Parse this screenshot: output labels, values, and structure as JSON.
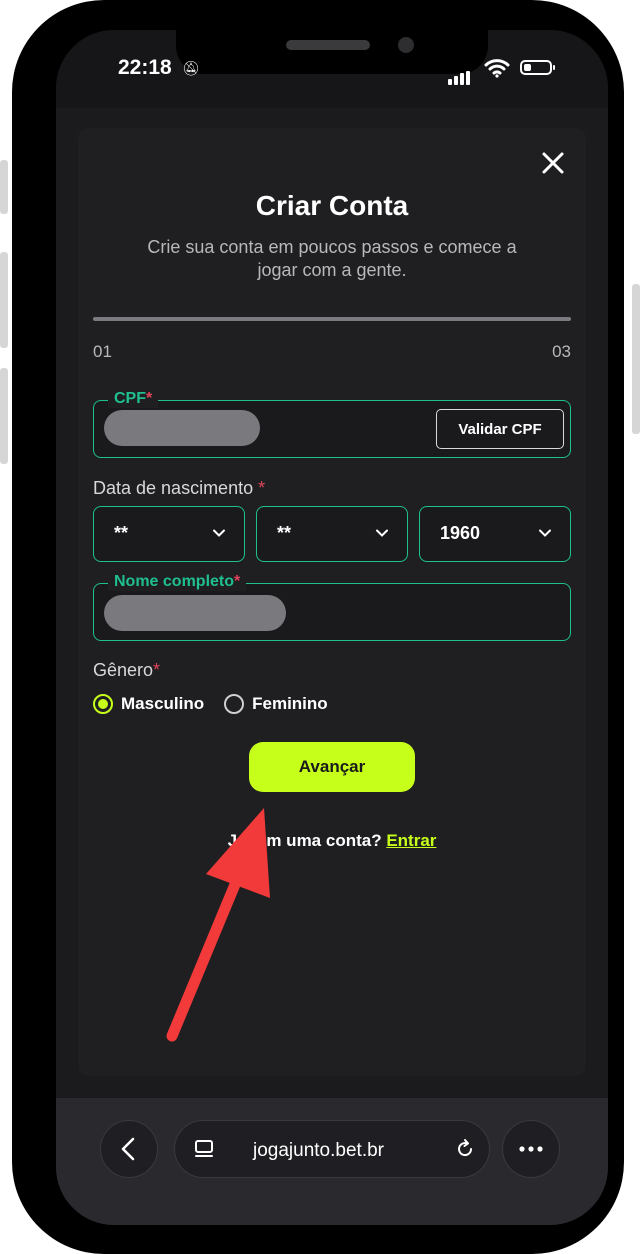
{
  "status_bar": {
    "time": "22:18"
  },
  "form": {
    "title": "Criar Conta",
    "subtitle": "Crie sua conta em poucos passos e comece a jogar com a gente.",
    "progress": {
      "fraction": 0.0
    },
    "step_start": "01",
    "step_end": "03",
    "cpf": {
      "label": "CPF",
      "required_mark": "*",
      "validate_button": "Validar CPF"
    },
    "birth": {
      "label": "Data de nascimento",
      "required_mark": "*",
      "day": "**",
      "month": "**",
      "year": "1960"
    },
    "name": {
      "label": "Nome completo",
      "required_mark": "*"
    },
    "gender": {
      "label": "Gênero",
      "required_mark": "*",
      "options": [
        {
          "label": "Masculino",
          "selected": true
        },
        {
          "label": "Feminino",
          "selected": false
        }
      ]
    },
    "submit_label": "Avançar",
    "login_prompt": "Já tem uma conta?",
    "login_link": "Entrar"
  },
  "browser": {
    "url": "jogajunto.bet.br"
  },
  "colors": {
    "accent": "#c6ff1a",
    "field_border": "#1fbf8f",
    "required": "#e0445a",
    "annotation_arrow": "#f23a3a"
  },
  "icons": [
    "close-icon",
    "chevron-down-icon",
    "back-icon",
    "tabs-icon",
    "reload-icon",
    "more-icon",
    "wifi-icon",
    "battery-icon",
    "mute-icon"
  ]
}
